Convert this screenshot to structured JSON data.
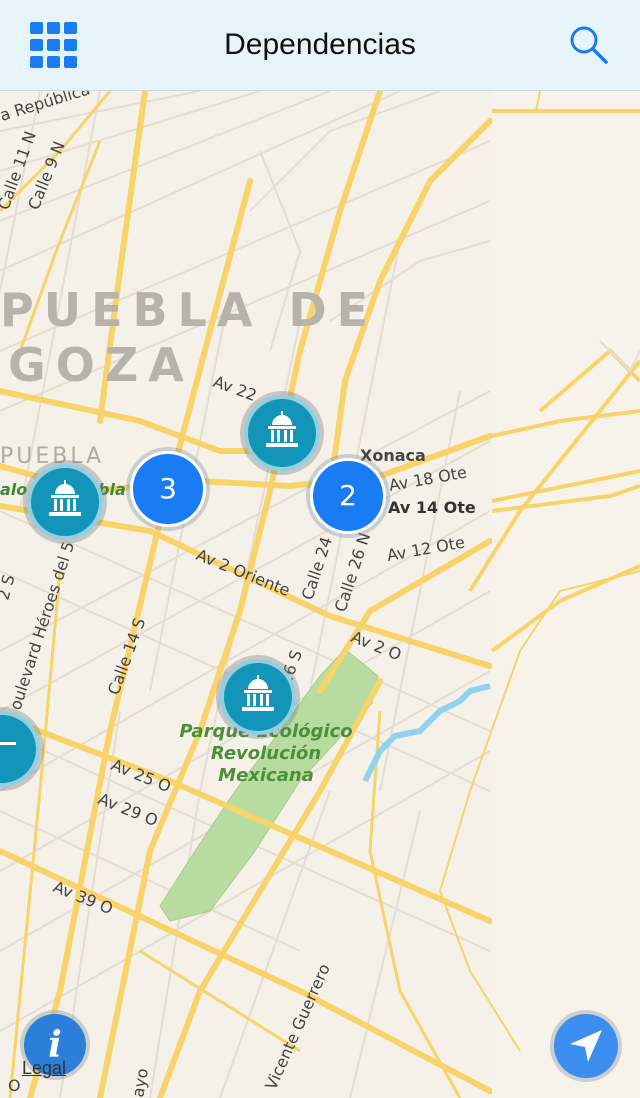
{
  "header": {
    "title": "Dependencias",
    "left_icon": "grid-menu-icon",
    "right_icon": "search-icon",
    "accent_color": "#1a7cf5"
  },
  "map": {
    "area_labels": [
      "PUEBLA DE",
      "GOZA",
      "PUEBLA"
    ],
    "street_labels": {
      "republica": "a República",
      "calle11n": "Calle 11 N",
      "calle9n": "Calle 9 N",
      "av22": "Av 22",
      "xonaca": "Xonaca",
      "av18ote": "Av 18 Ote",
      "av14ote": "Av 14 Ote",
      "av12ote": "Av 12 Ote",
      "av2oriente": "Av 2 Oriente",
      "calle24": "Calle 24",
      "calle26n": "Calle 26 N",
      "av2o": "Av 2 O",
      "heroes": "oulevard Héroes del 5 de",
      "calle14s": "Calle 14 S",
      "calle26s": "26 S",
      "av25o": "Av 25 O",
      "av29o": "Av 29 O",
      "av39o": "Av 39 O",
      "vicenteguerrero": "Vicente Guerrero",
      "s2": "2 S",
      "ayo": "ayo",
      "o": "O",
      "zocalo": "alo",
      "bla": "bla"
    },
    "park_name": [
      "Parque Ecológico",
      "Revolución",
      "Mexicana"
    ],
    "clusters": [
      {
        "count": "3"
      },
      {
        "count": "2"
      }
    ],
    "pin_icon": "government-building-icon",
    "colors": {
      "land": "#f6f1e8",
      "major_road": "#f7d36a",
      "park": "#b8dca0",
      "water": "#8fd3ee",
      "pin": "#1295b8"
    }
  },
  "controls": {
    "info_symbol": "i",
    "legal_label": "Legal",
    "locate_icon": "location-arrow-icon"
  }
}
